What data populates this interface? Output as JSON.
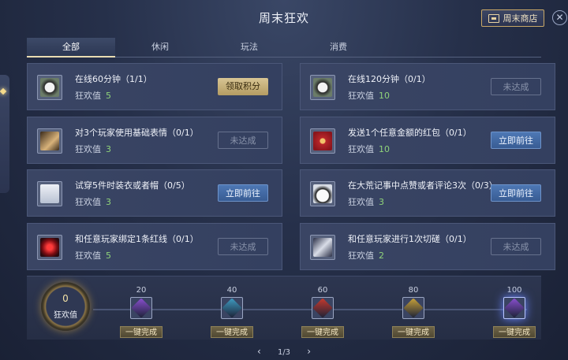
{
  "title": "周末狂欢",
  "shop_button": "周末商店",
  "tabs": [
    "全部",
    "休闲",
    "玩法",
    "消费"
  ],
  "points_label": "狂欢值",
  "tasks_left": [
    {
      "name": "在线60分钟（1/1）",
      "points": "5",
      "button": "领取积分",
      "state": "claim",
      "icon": "panda-icon"
    },
    {
      "name": "对3个玩家使用基础表情（0/1）",
      "points": "3",
      "button": "未达成",
      "state": "na",
      "icon": "gesture-icon"
    },
    {
      "name": "试穿5件时装衣或者帽（0/5）",
      "points": "3",
      "button": "立即前往",
      "state": "go",
      "icon": "clothing-icon"
    },
    {
      "name": "和任意玩家绑定1条红线（0/1）",
      "points": "5",
      "button": "未达成",
      "state": "na",
      "icon": "red-thread-icon"
    }
  ],
  "tasks_right": [
    {
      "name": "在线120分钟（0/1）",
      "points": "10",
      "button": "未达成",
      "state": "na",
      "icon": "panda-icon"
    },
    {
      "name": "发送1个任意金额的红包（0/1）",
      "points": "10",
      "button": "立即前往",
      "state": "go",
      "icon": "red-envelope-icon"
    },
    {
      "name": "在大荒记事中点赞或者评论3次（0/3）",
      "points": "3",
      "button": "立即前往",
      "state": "go",
      "icon": "panda-face-icon"
    },
    {
      "name": "和任意玩家进行1次切磋（0/1）",
      "points": "2",
      "button": "未达成",
      "state": "na",
      "icon": "crossed-swords-icon"
    }
  ],
  "progress": {
    "current": "0",
    "label": "狂欢值",
    "milestones": [
      {
        "value": "20",
        "button": "一键完成",
        "color": "#8a4fd0"
      },
      {
        "value": "40",
        "button": "一键完成",
        "color": "#3f9cc2"
      },
      {
        "value": "60",
        "button": "一键完成",
        "color": "#c83a2e"
      },
      {
        "value": "80",
        "button": "一键完成",
        "color": "#c8a23a"
      },
      {
        "value": "100",
        "button": "一键完成",
        "color": "#8a4fd0"
      }
    ]
  },
  "pager": "1/3"
}
